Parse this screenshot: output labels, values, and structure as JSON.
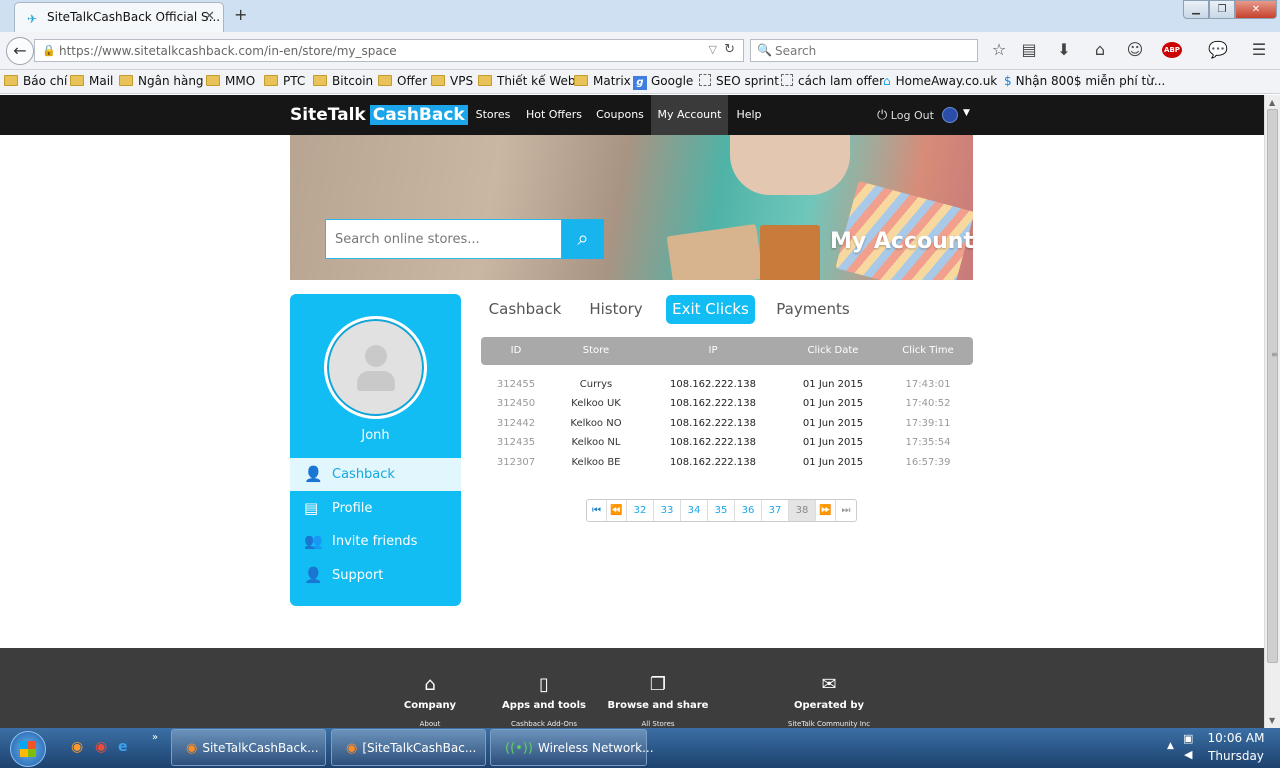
{
  "browser": {
    "tab_title": "SiteTalkCashBack Official S...",
    "url": "https://www.sitetalkcashback.com/in-en/store/my_space",
    "search_placeholder": "Search",
    "bookmarks": [
      "Báo chí",
      "Mail",
      "Ngân hàng",
      "MMO",
      "PTC",
      "Bitcoin",
      "Offer",
      "VPS",
      "Thiết kế Web",
      "Matrix",
      "Google",
      "SEO sprint",
      "cách lam offer",
      "HomeAway.co.uk",
      "Nhận 800$ miễn phí từ..."
    ]
  },
  "site": {
    "logo_left": "SiteTalk",
    "logo_right": "CashBack",
    "nav": [
      "Stores",
      "Hot Offers",
      "Coupons",
      "My Account",
      "Help"
    ],
    "logout": "Log Out",
    "hero_search_placeholder": "Search online stores...",
    "hero_title": "My Account"
  },
  "sidebar": {
    "username": "Jonh",
    "items": [
      {
        "label": "Cashback",
        "icon": "user-money-icon",
        "active": true
      },
      {
        "label": "Profile",
        "icon": "profile-card-icon"
      },
      {
        "label": "Invite friends",
        "icon": "invite-friends-icon"
      },
      {
        "label": "Support",
        "icon": "support-icon"
      }
    ]
  },
  "tabs": [
    "Cashback",
    "History",
    "Exit Clicks",
    "Payments"
  ],
  "table": {
    "headers": [
      "ID",
      "Store",
      "IP",
      "Click Date",
      "Click Time"
    ],
    "rows": [
      [
        "312455",
        "Currys",
        "108.162.222.138",
        "01 Jun 2015",
        "17:43:01"
      ],
      [
        "312450",
        "Kelkoo UK",
        "108.162.222.138",
        "01 Jun 2015",
        "17:40:52"
      ],
      [
        "312442",
        "Kelkoo NO",
        "108.162.222.138",
        "01 Jun 2015",
        "17:39:11"
      ],
      [
        "312435",
        "Kelkoo NL",
        "108.162.222.138",
        "01 Jun 2015",
        "17:35:54"
      ],
      [
        "312307",
        "Kelkoo BE",
        "108.162.222.138",
        "01 Jun 2015",
        "16:57:39"
      ]
    ]
  },
  "pagination": {
    "pages": [
      "32",
      "33",
      "34",
      "35",
      "36",
      "37",
      "38"
    ],
    "current": "38"
  },
  "footer": {
    "columns": [
      {
        "title": "Company",
        "sub": "About",
        "icon": "home-icon"
      },
      {
        "title": "Apps and tools",
        "sub": "Cashback Add-Ons",
        "icon": "phone-icon"
      },
      {
        "title": "Browse and share",
        "sub": "All Stores",
        "icon": "browse-icon"
      },
      {
        "title": "Operated by",
        "sub": "SiteTalk Community Inc",
        "icon": "mail-icon"
      }
    ]
  },
  "taskbar": {
    "tasks": [
      "SiteTalkCashBack...",
      "[SiteTalkCashBac...",
      "Wireless Network..."
    ],
    "time": "10:06 AM",
    "day": "Thursday"
  },
  "colors": {
    "accent": "#12bdf4",
    "navbar": "#161616",
    "footer": "#3d3d3d"
  }
}
